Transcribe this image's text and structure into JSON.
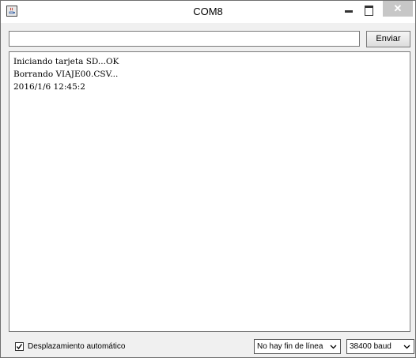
{
  "window": {
    "title": "COM8",
    "close_glyph": "✕"
  },
  "send": {
    "input_value": "",
    "button_label": "Enviar"
  },
  "output": {
    "lines": [
      "Iniciando tarjeta SD...OK",
      "Borrando VIAJE00.CSV...",
      "2016/1/6 12:45:2"
    ]
  },
  "footer": {
    "autoscroll_label": "Desplazamiento automático",
    "autoscroll_checked": true,
    "line_ending_selected": "No hay fin de línea",
    "baud_selected": "38400 baud"
  },
  "icons": {
    "app": "java-app-icon",
    "minimize": "minimize-icon",
    "maximize": "maximize-icon",
    "close": "close-icon",
    "dropdown": "chevron-down-icon",
    "check": "check-icon"
  },
  "colors": {
    "close_button_bg": "#c7c7c7",
    "window_bg": "#f0f0f0",
    "border": "#7a7a7a"
  }
}
